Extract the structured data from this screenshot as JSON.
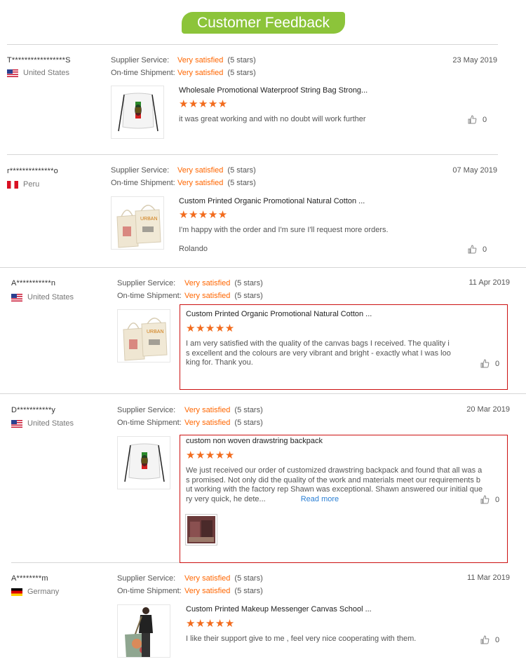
{
  "banner": {
    "title": "Customer Feedback"
  },
  "labels": {
    "supplier_service": "Supplier Service:",
    "ontime_shipment": "On-time Shipment:",
    "read_more": "Read more"
  },
  "colors": {
    "banner_green": "#8cc43a",
    "accent_orange": "#ff6600",
    "star_orange": "#f26b1d",
    "highlight_red": "#cc1111",
    "link_blue": "#2a7fd4"
  },
  "reviews": [
    {
      "user": "T*****************S",
      "country": "United States",
      "flag": "us-flag",
      "supplier_service": "Very satisfied",
      "supplier_stars": "(5 stars)",
      "shipment": "Very satisfied",
      "shipment_stars": "(5 stars)",
      "date": "23 May 2019",
      "product_title": "Wholesale Promotional Waterproof String Bag Strong...",
      "rating_stars": "★★★★★",
      "comment": "it was great working and with no doubt will work further",
      "likes": "0"
    },
    {
      "user": "r**************o",
      "country": "Peru",
      "flag": "pe-flag",
      "supplier_service": "Very satisfied",
      "supplier_stars": "(5 stars)",
      "shipment": "Very satisfied",
      "shipment_stars": "(5 stars)",
      "date": "07 May 2019",
      "product_title": "Custom Printed Organic Promotional Natural Cotton ...",
      "rating_stars": "★★★★★",
      "comment": "I'm happy with the order and I'm sure I'll request more orders.",
      "signature": "Rolando",
      "likes": "0"
    },
    {
      "user": "A***********n",
      "country": "United States",
      "flag": "us-flag",
      "supplier_service": "Very satisfied",
      "supplier_stars": "(5 stars)",
      "shipment": "Very satisfied",
      "shipment_stars": "(5 stars)",
      "date": "11 Apr 2019",
      "product_title": "Custom Printed Organic Promotional Natural Cotton ...",
      "rating_stars": "★★★★★",
      "comment_lines": [
        "I am very satisfied with the quality of the canvas bags I received. The quality i",
        "s excellent and the colours are very vibrant and bright - exactly what I was loo",
        "king for. Thank you."
      ],
      "likes": "0"
    },
    {
      "user": "D***********y",
      "country": "United States",
      "flag": "us-flag",
      "supplier_service": "Very satisfied",
      "supplier_stars": "(5 stars)",
      "shipment": "Very satisfied",
      "shipment_stars": "(5 stars)",
      "date": "20 Mar 2019",
      "product_title": "custom non woven drawstring backpack",
      "rating_stars": "★★★★★",
      "comment_lines": [
        "We just received our order of customized drawstring backpack and found that all was a",
        "s promised.  Not only did the quality of the work and materials meet our requirements b",
        "ut working with the factory rep Shawn was exceptional.  Shawn answered our initial que",
        "ry very quick, he dete..."
      ],
      "likes": "0"
    },
    {
      "user": "A********m",
      "country": "Germany",
      "flag": "de-flag",
      "supplier_service": "Very satisfied",
      "supplier_stars": "(5 stars)",
      "shipment": "Very satisfied",
      "shipment_stars": "(5 stars)",
      "date": "11 Mar 2019",
      "product_title": "Custom Printed Makeup Messenger Canvas School ...",
      "rating_stars": "★★★★★",
      "comment": "I like their support give to me , feel very nice cooperating with them.",
      "likes": "0"
    }
  ]
}
